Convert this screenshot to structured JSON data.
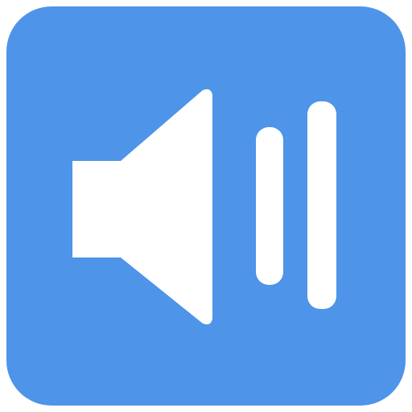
{
  "app_icon": {
    "icon": "speaker-volume-icon",
    "background_color": "#4e94e8",
    "foreground_color": "#ffffff"
  }
}
